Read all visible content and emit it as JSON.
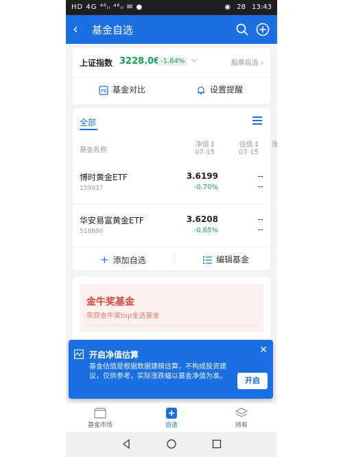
{
  "status_bar": {
    "left": "HD 4G ⁴⁶ᵢₗ ⁴⁶ᵢₗ ✉ ●",
    "battery": "28",
    "time": "13:43"
  },
  "header": {
    "title": "基金自选"
  },
  "index": {
    "name": "上证指数",
    "value": "3228.06",
    "change": "-1.64%",
    "link": "股票自选"
  },
  "quick_actions": {
    "compare": "基金对比",
    "alert": "设置提醒"
  },
  "watchlist": {
    "tab_all": "全部",
    "col_name": "基金名称",
    "col_nav": "净值",
    "col_nav_date": "07-15",
    "col_est": "估值",
    "col_est_date": "07-15",
    "col_more": "涨",
    "rows": [
      {
        "name": "博时黄金ETF",
        "code": "159937",
        "nav": "3.6199",
        "change": "-0.70%",
        "est": "--",
        "est_pct": "--"
      },
      {
        "name": "华安易富黄金ETF",
        "code": "518880",
        "nav": "3.6208",
        "change": "-0.65%",
        "est": "--",
        "est_pct": "--"
      }
    ],
    "add_label": "添加自选",
    "edit_label": "编辑基金"
  },
  "promo": {
    "title": "金牛奖基金",
    "subtitle": "荣获金牛奖top金选基金"
  },
  "popup": {
    "title": "开启净值估算",
    "text": "基金估值是根据数据建模估算，不构成投资建议，仅供参考，实际涨跌幅以基金净值为准。",
    "button": "开启"
  },
  "bottom_nav": {
    "market": "基金市场",
    "watchlist": "自选",
    "holdings": "持有"
  },
  "colors": {
    "primary": "#1b6fe3",
    "down": "#1a9e5b",
    "promo": "#d9473b"
  }
}
